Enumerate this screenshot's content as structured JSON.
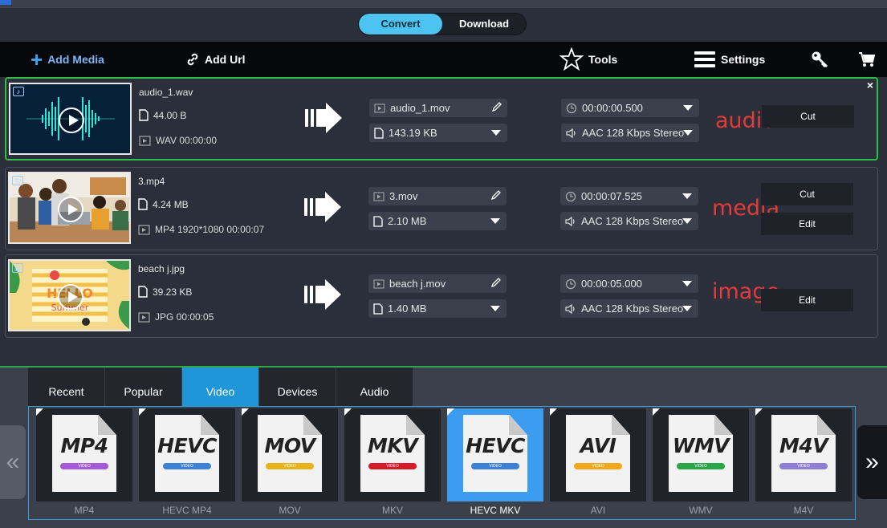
{
  "mode": {
    "convert": "Convert",
    "download": "Download"
  },
  "toolbar": {
    "add_media": "Add Media",
    "add_url": "Add Url",
    "tools": "Tools",
    "settings": "Settings"
  },
  "rows": [
    {
      "name": "audio_1.wav",
      "size": "44.00 B",
      "meta": "WAV 00:00:00",
      "out_name": "audio_1.mov",
      "out_size": "143.19 KB",
      "duration": "00:00:00.500",
      "audio": "AAC 128 Kbps Stereo",
      "annotation": "audio",
      "buttons": [
        "Cut"
      ]
    },
    {
      "name": "3.mp4",
      "size": "4.24 MB",
      "meta": "MP4 1920*1080 00:00:07",
      "out_name": "3.mov",
      "out_size": "2.10 MB",
      "duration": "00:00:07.525",
      "audio": "AAC 128 Kbps Stereo",
      "annotation": "media",
      "buttons": [
        "Cut",
        "Edit"
      ]
    },
    {
      "name": "beach  j.jpg",
      "size": "39.23 KB",
      "meta": "JPG 00:00:05",
      "out_name": "beach  j.mov",
      "out_size": "1.40 MB",
      "duration": "00:00:05.000",
      "audio": "AAC 128 Kbps Stereo",
      "annotation": "image",
      "buttons": [
        "Edit"
      ]
    }
  ],
  "thumb_texts": {
    "beach_title": "HELLO",
    "beach_sub": "Summer"
  },
  "tabs": [
    "Recent",
    "Popular",
    "Video",
    "Devices",
    "Audio"
  ],
  "active_tab": "Video",
  "formats": [
    {
      "ext": "MP4",
      "label": "MP4",
      "color": "#a45ad8"
    },
    {
      "ext": "HEVC",
      "label": "HEVC MP4",
      "color": "#3b82d6"
    },
    {
      "ext": "MOV",
      "label": "MOV",
      "color": "#e8b21c"
    },
    {
      "ext": "MKV",
      "label": "MKV",
      "color": "#d8192a"
    },
    {
      "ext": "HEVC",
      "label": "HEVC MKV",
      "color": "#3b82d6"
    },
    {
      "ext": "AVI",
      "label": "AVI",
      "color": "#f2a81a"
    },
    {
      "ext": "WMV",
      "label": "WMV",
      "color": "#2aa54a"
    },
    {
      "ext": "M4V",
      "label": "M4V",
      "color": "#8f7ed6"
    }
  ],
  "pill_text": "VIDEO",
  "selected_format": "HEVC MKV",
  "nav": {
    "prev": "«",
    "next": "»"
  },
  "close": "×"
}
